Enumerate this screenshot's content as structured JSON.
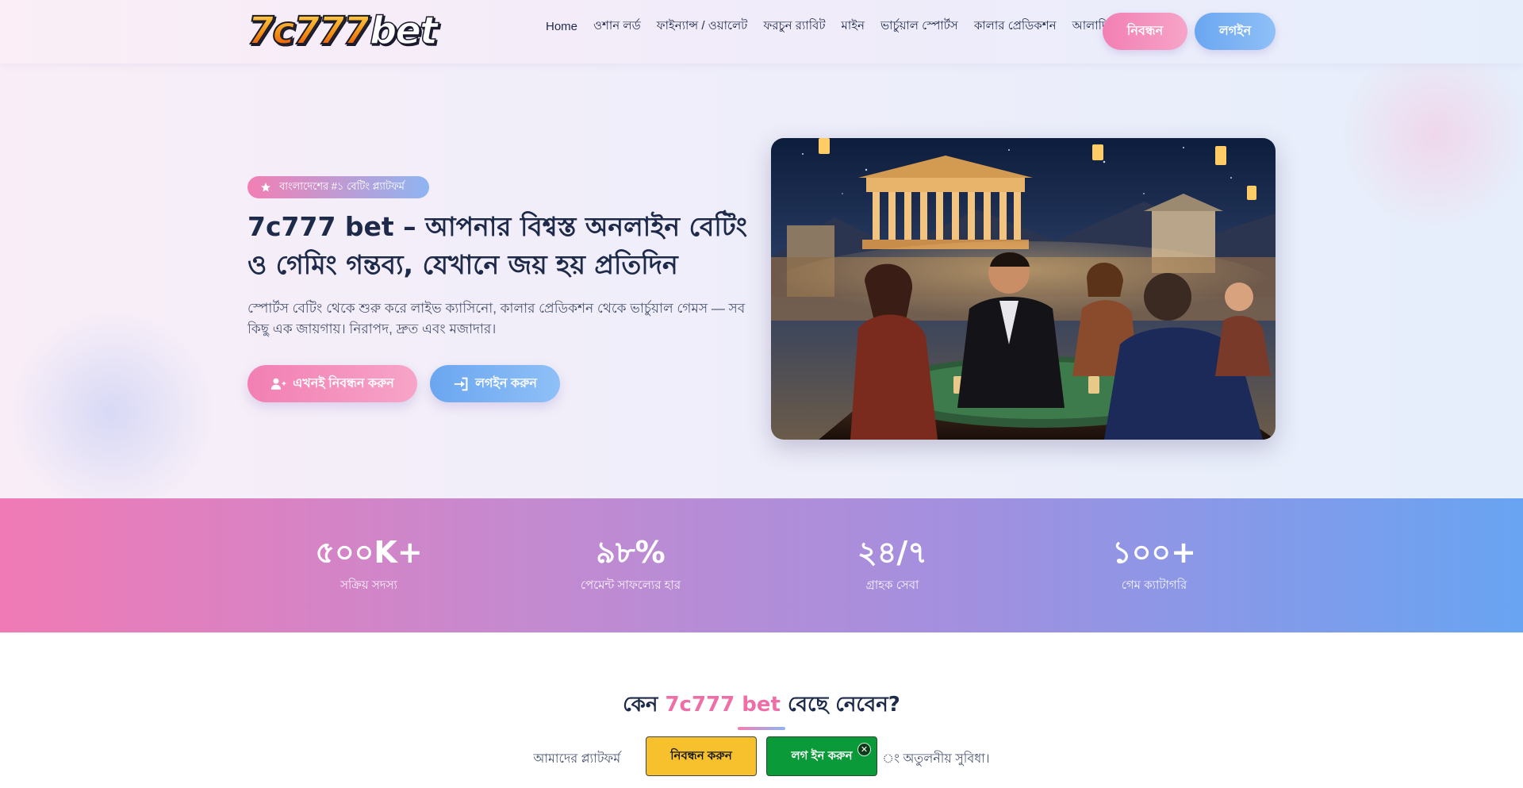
{
  "header": {
    "logo_part1": "7c777",
    "logo_part2": "bet",
    "nav": [
      "Home",
      "ওশান লর্ড",
      "ফাইন্যান্স / ওয়ালেট",
      "ফরচুন র‍্যাবিট",
      "মাইন",
      "ভার্চুয়াল স্পোর্টস",
      "কালার প্রেডিকশন",
      "আলাদিন"
    ],
    "register_label": "নিবন্ধন",
    "login_label": "লগইন"
  },
  "hero": {
    "badge": "বাংলাদেশের #১ বেটিং প্ল্যাটফর্ম",
    "title": "7c777 bet – আপনার বিশ্বস্ত অনলাইন বেটিং ও গেমিং গন্তব্য, যেখানে জয় হয় প্রতিদিন",
    "description": "স্পোর্টস বেটিং থেকে শুরু করে লাইভ ক্যাসিনো, কালার প্রেডিকশন থেকে ভার্চুয়াল গেমস — সব কিছু এক জায়গায়। নিরাপদ, দ্রুত এবং মজাদার।",
    "cta_register": "এখনই নিবন্ধন করুন",
    "cta_login": "লগইন করুন"
  },
  "stats": [
    {
      "value": "৫০০K+",
      "label": "সক্রিয় সদস্য"
    },
    {
      "value": "৯৮%",
      "label": "পেমেন্ট সাফল্যের হার"
    },
    {
      "value": "২৪/৭",
      "label": "গ্রাহক সেবা"
    },
    {
      "value": "১০০+",
      "label": "গেম ক্যাটাগরি"
    }
  ],
  "why": {
    "title_pre": "কেন ",
    "title_highlight": "7c777 bet",
    "title_post": " বেছে নেবেন?",
    "subtitle_left": "আমাদের প্ল্যাটফর্ম",
    "subtitle_right": "ং অতুলনীয় সুবিধা।"
  },
  "sticky": {
    "register": "নিবন্ধন করুন",
    "login": "লগ ইন করুন",
    "close": "✕"
  },
  "colors": {
    "pink": "#f27fb3",
    "blue": "#6aa6f0",
    "dark": "#1e2a4a",
    "sticky_yellow": "#f6c12c",
    "sticky_green": "#0a9a3a"
  }
}
